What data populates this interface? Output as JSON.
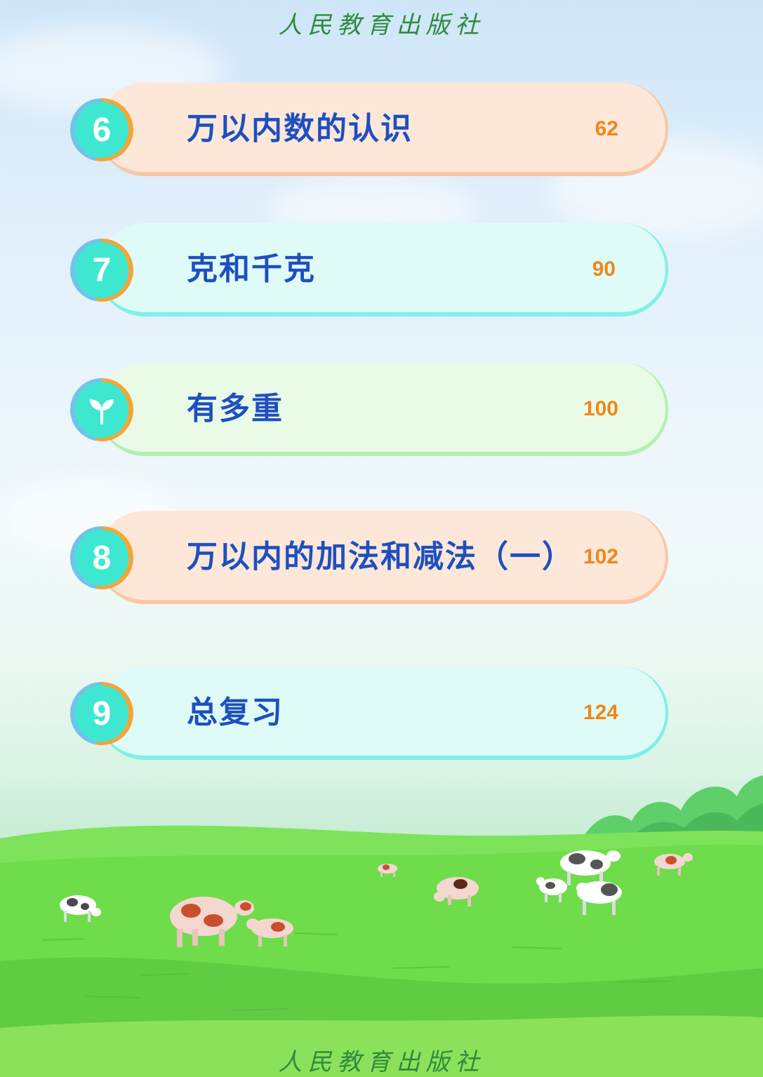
{
  "header": {
    "publisher": "人民教育出版社"
  },
  "footer": {
    "publisher": "人民教育出版社"
  },
  "toc": [
    {
      "number": "6",
      "title": "万以内数的认识",
      "page": "62",
      "color": "peach",
      "icon": "number"
    },
    {
      "number": "7",
      "title": "克和千克",
      "page": "90",
      "color": "cyan",
      "icon": "number"
    },
    {
      "number": "",
      "title": "有多重",
      "page": "100",
      "color": "green",
      "icon": "sprout-icon"
    },
    {
      "number": "8",
      "title": "万以内的加法和减法（一）",
      "page": "102",
      "color": "peach",
      "icon": "number"
    },
    {
      "number": "9",
      "title": "总复习",
      "page": "124",
      "color": "cyan",
      "icon": "number"
    }
  ],
  "colors": {
    "title_blue": "#1e4fc0",
    "page_orange": "#f0861a",
    "badge_teal": "#3ee8d0",
    "grass_green": "#6fdc4c"
  }
}
